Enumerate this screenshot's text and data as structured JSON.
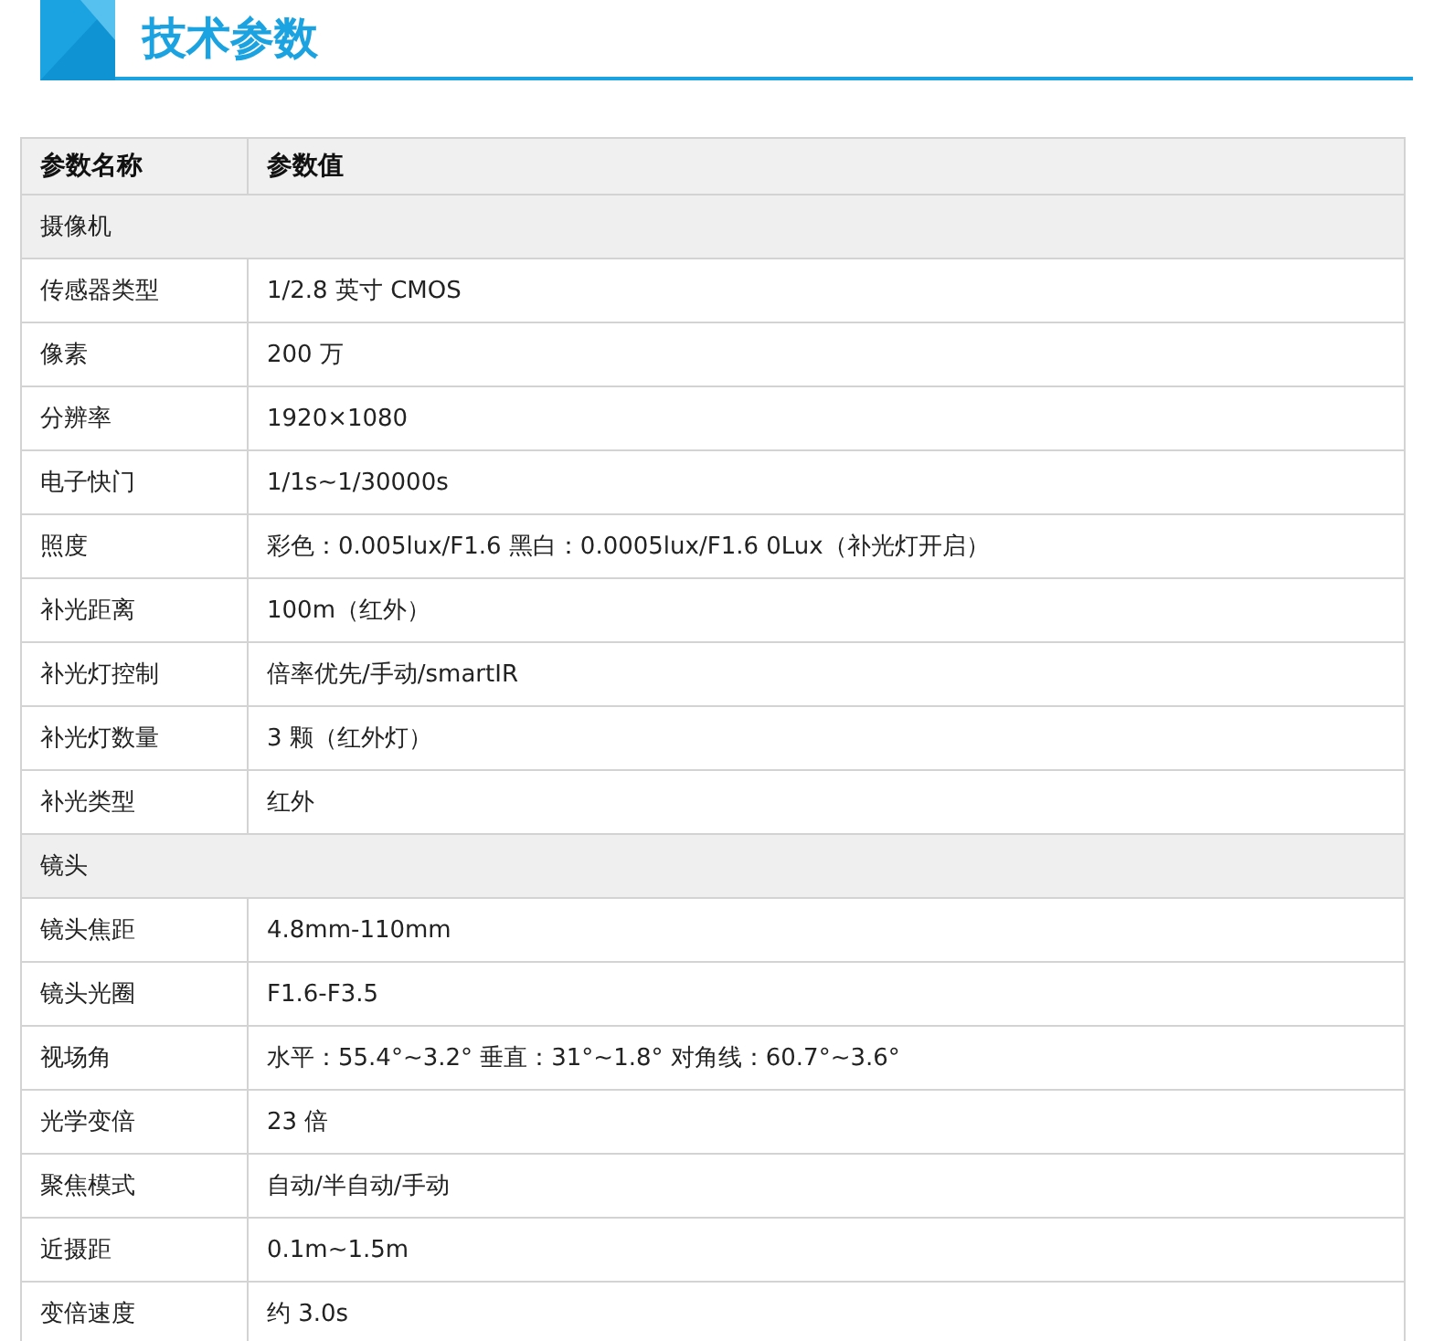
{
  "heading": {
    "title": "技术参数"
  },
  "table": {
    "columns": [
      "参数名称",
      "参数值"
    ],
    "rows": [
      {
        "kind": "section",
        "label": "摄像机"
      },
      {
        "kind": "row",
        "name": "传感器类型",
        "value": "1/2.8 英寸  CMOS"
      },
      {
        "kind": "row",
        "name": "像素",
        "value": "200 万"
      },
      {
        "kind": "row",
        "name": "分辨率",
        "value": "1920×1080"
      },
      {
        "kind": "row",
        "name": "电子快门",
        "value": "1/1s~1/30000s"
      },
      {
        "kind": "row",
        "name": "照度",
        "value": "彩色：0.005lux/F1.6  黑白：0.0005lux/F1.6 0Lux（补光灯开启）"
      },
      {
        "kind": "row",
        "name": "补光距离",
        "value": "100m（红外）"
      },
      {
        "kind": "row",
        "name": "补光灯控制",
        "value": "倍率优先/手动/smartIR"
      },
      {
        "kind": "row",
        "name": "补光灯数量",
        "value": "3 颗（红外灯）"
      },
      {
        "kind": "row",
        "name": "补光类型",
        "value": "红外"
      },
      {
        "kind": "section",
        "label": "镜头"
      },
      {
        "kind": "row",
        "name": "镜头焦距",
        "value": "4.8mm-110mm"
      },
      {
        "kind": "row",
        "name": "镜头光圈",
        "value": "F1.6-F3.5"
      },
      {
        "kind": "row",
        "name": "视场角",
        "value": "水平：55.4°~3.2°     垂直：31°~1.8°   对角线：60.7°~3.6°"
      },
      {
        "kind": "row",
        "name": "光学变倍",
        "value": "23 倍"
      },
      {
        "kind": "row",
        "name": "聚焦模式",
        "value": "自动/半自动/手动"
      },
      {
        "kind": "row",
        "name": "近摄距",
        "value": "0.1m~1.5m"
      },
      {
        "kind": "row",
        "name": "变倍速度",
        "value": "约 3.0s"
      }
    ]
  }
}
